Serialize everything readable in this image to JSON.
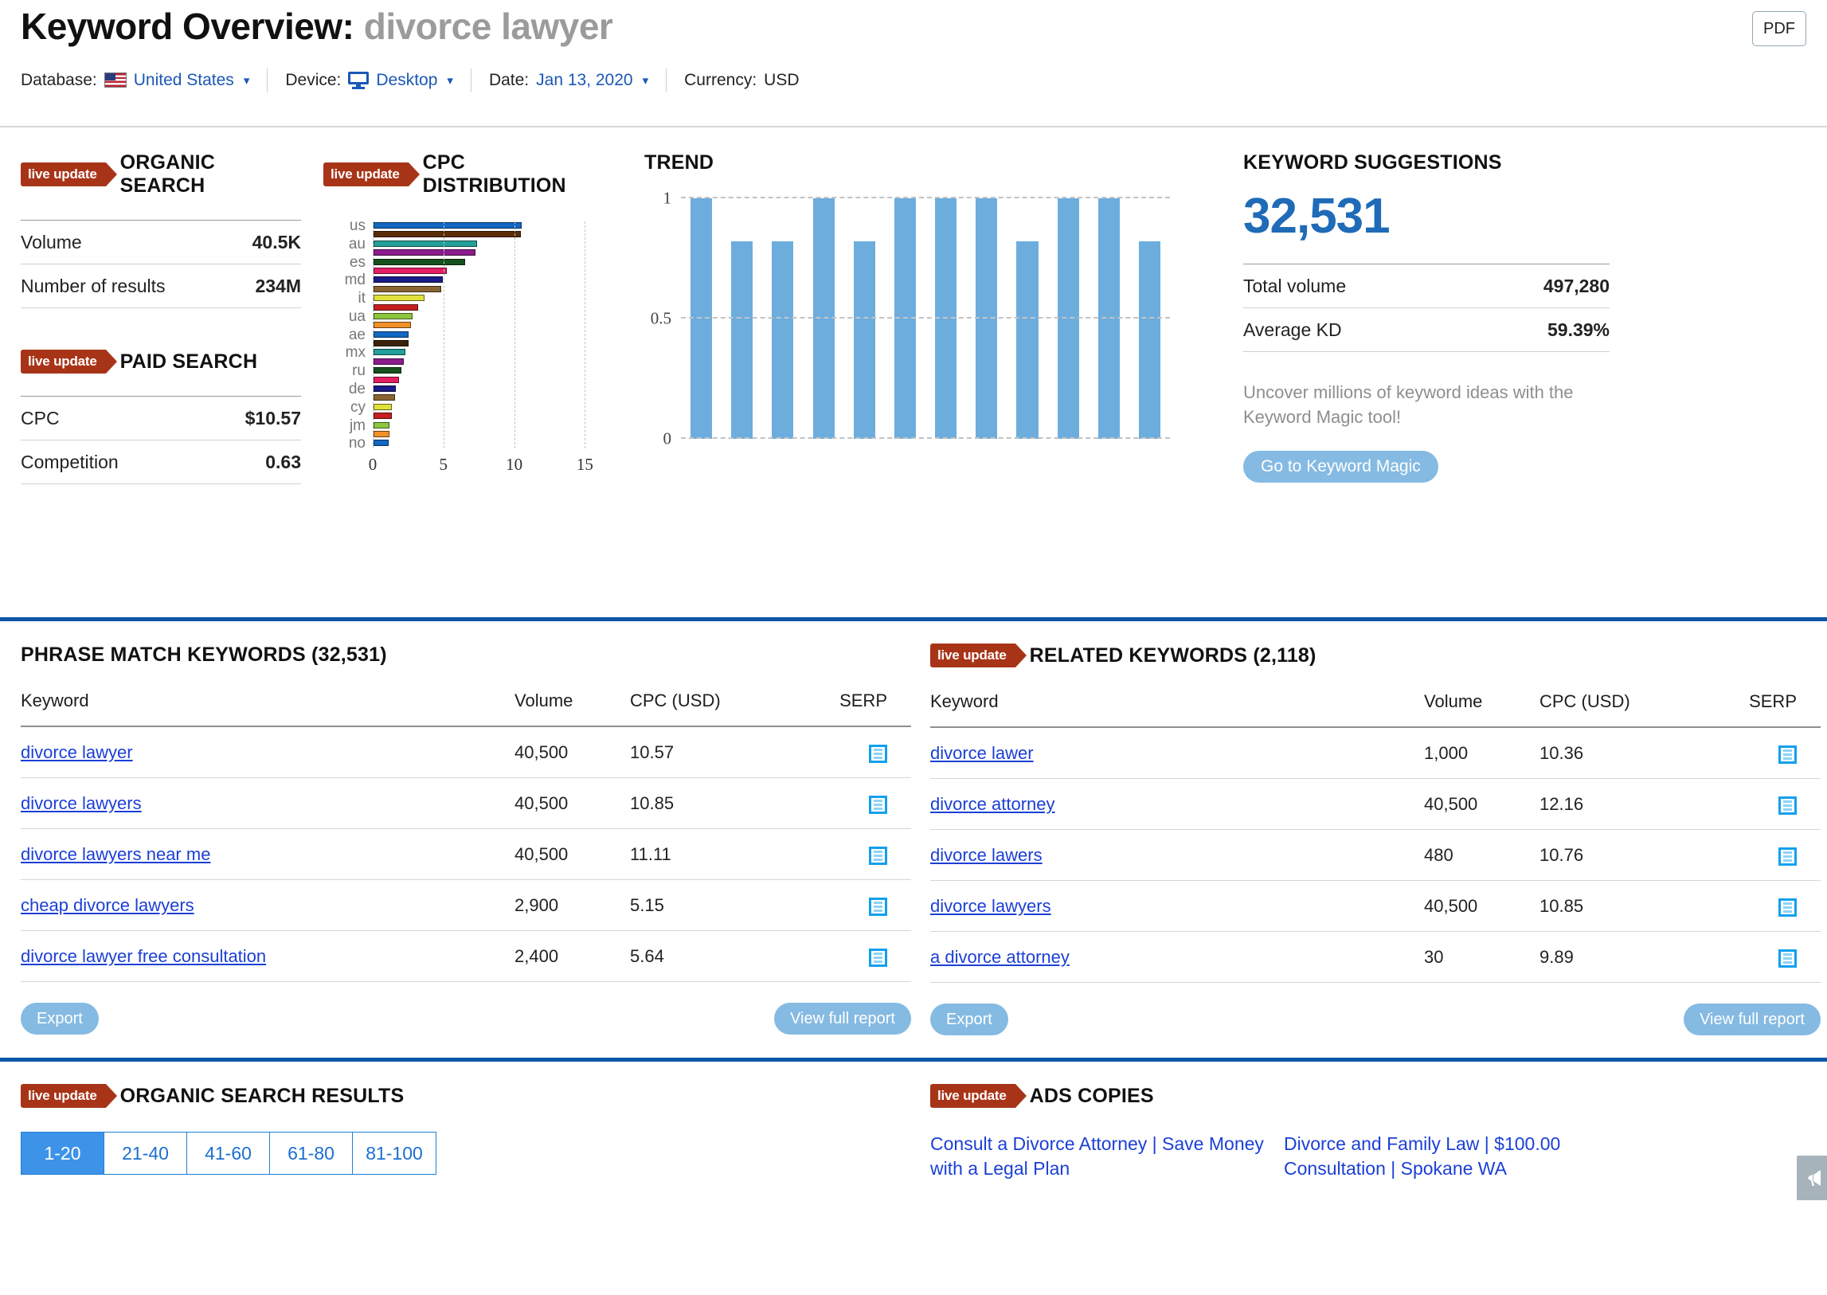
{
  "header": {
    "title_prefix": "Keyword Overview:",
    "keyword": "divorce lawyer",
    "pdf_label": "PDF",
    "database_label": "Database:",
    "database_value": "United States",
    "device_label": "Device:",
    "device_value": "Desktop",
    "date_label": "Date:",
    "date_value": "Jan 13, 2020",
    "currency_label": "Currency:",
    "currency_value": "USD"
  },
  "badges": {
    "live_update": "live update"
  },
  "organic_search": {
    "title": "ORGANIC SEARCH",
    "rows": [
      {
        "label": "Volume",
        "value": "40.5K"
      },
      {
        "label": "Number of results",
        "value": "234M"
      }
    ]
  },
  "paid_search": {
    "title": "PAID SEARCH",
    "rows": [
      {
        "label": "CPC",
        "value": "$10.57"
      },
      {
        "label": "Competition",
        "value": "0.63"
      }
    ]
  },
  "cpc_distribution": {
    "title": "CPC DISTRIBUTION"
  },
  "trend": {
    "title": "TREND"
  },
  "keyword_suggestions": {
    "title": "KEYWORD SUGGESTIONS",
    "count": "32,531",
    "rows": [
      {
        "label": "Total volume",
        "value": "497,280"
      },
      {
        "label": "Average KD",
        "value": "59.39%"
      }
    ],
    "note": "Uncover millions of keyword ideas with the Keyword Magic tool!",
    "cta": "Go to Keyword Magic"
  },
  "phrase_match": {
    "title": "PHRASE MATCH KEYWORDS (32,531)",
    "columns": [
      "Keyword",
      "Volume",
      "CPC (USD)",
      "SERP"
    ],
    "rows": [
      {
        "keyword": "divorce lawyer",
        "volume": "40,500",
        "cpc": "10.57",
        "serp": "serp-icon"
      },
      {
        "keyword": "divorce lawyers",
        "volume": "40,500",
        "cpc": "10.85",
        "serp": "serp-icon"
      },
      {
        "keyword": "divorce lawyers near me",
        "volume": "40,500",
        "cpc": "11.11",
        "serp": "serp-icon"
      },
      {
        "keyword": "cheap divorce lawyers",
        "volume": "2,900",
        "cpc": "5.15",
        "serp": "serp-icon"
      },
      {
        "keyword": "divorce lawyer free consultation",
        "volume": "2,400",
        "cpc": "5.64",
        "serp": "serp-icon"
      }
    ],
    "export_label": "Export",
    "view_full_label": "View full report"
  },
  "related_keywords": {
    "title": "RELATED KEYWORDS (2,118)",
    "columns": [
      "Keyword",
      "Volume",
      "CPC (USD)",
      "SERP"
    ],
    "rows": [
      {
        "keyword": "divorce lawer",
        "volume": "1,000",
        "cpc": "10.36",
        "serp": "serp-icon"
      },
      {
        "keyword": "divorce attorney",
        "volume": "40,500",
        "cpc": "12.16",
        "serp": "serp-icon"
      },
      {
        "keyword": "divorce lawers",
        "volume": "480",
        "cpc": "10.76",
        "serp": "serp-icon"
      },
      {
        "keyword": "divorce lawyers",
        "volume": "40,500",
        "cpc": "10.85",
        "serp": "serp-icon"
      },
      {
        "keyword": "a divorce attorney",
        "volume": "30",
        "cpc": "9.89",
        "serp": "serp-icon"
      }
    ],
    "export_label": "Export",
    "view_full_label": "View full report"
  },
  "organic_search_results": {
    "title": "ORGANIC SEARCH RESULTS",
    "pages": [
      "1-20",
      "21-40",
      "41-60",
      "61-80",
      "81-100"
    ],
    "active_page": "1-20"
  },
  "ads_copies": {
    "title": "ADS COPIES",
    "items": [
      "Consult a Divorce Attorney | Save Money with a Legal Plan",
      "Divorce and Family Law | $100.00 Consultation | Spokane WA"
    ]
  },
  "colors": {
    "accent_blue": "#1b57b5",
    "divider_blue": "#0d55a8",
    "live_badge_red": "#a83418",
    "link_blue": "#1b3fd6",
    "trend_bar": "#6cadde",
    "button_blue": "#85bae2"
  },
  "chart_data": [
    {
      "type": "bar",
      "title": "CPC DISTRIBUTION",
      "orientation": "horizontal",
      "xlabel": "",
      "ylabel": "",
      "xlim": [
        0,
        16.5
      ],
      "xticks": [
        0,
        5,
        10,
        15
      ],
      "grid": true,
      "categories": [
        "us",
        "",
        "au",
        "",
        "es",
        "",
        "md",
        "",
        "it",
        "",
        "ua",
        "",
        "ae",
        "",
        "mx",
        "",
        "ru",
        "",
        "de",
        "",
        "cy",
        "",
        "jm",
        "",
        "no"
      ],
      "visible_labels": [
        "us",
        "au",
        "es",
        "md",
        "it",
        "ua",
        "ae",
        "mx",
        "ru",
        "de",
        "cy",
        "jm",
        "no"
      ],
      "values": [
        10.5,
        10.45,
        7.35,
        7.25,
        6.5,
        5.2,
        4.9,
        4.8,
        3.6,
        3.15,
        2.75,
        2.65,
        2.5,
        2.5,
        2.25,
        2.15,
        2.0,
        1.8,
        1.6,
        1.5,
        1.3,
        1.3,
        1.15,
        1.15,
        1.1
      ],
      "bar_colors": [
        "#1268c3",
        "#5a2c08",
        "#22a09a",
        "#8d1b8d",
        "#14511c",
        "#e51e63",
        "#191b86",
        "#8a6531",
        "#e0e03a",
        "#c52020",
        "#8cc63f",
        "#f09027",
        "#1268c3",
        "#3b2209",
        "#22a09a",
        "#8d1b8d",
        "#14511c",
        "#e51e63",
        "#191b86",
        "#8a6531",
        "#e0e03a",
        "#c52020",
        "#8cc63f",
        "#f09027",
        "#1268c3"
      ]
    },
    {
      "type": "bar",
      "title": "TREND",
      "orientation": "vertical",
      "xlabel": "",
      "ylabel": "",
      "ylim": [
        0,
        1
      ],
      "yticks": [
        0,
        0.5,
        1
      ],
      "ytick_labels": [
        "0",
        "0.5",
        "1"
      ],
      "grid": true,
      "categories": [
        "1",
        "2",
        "3",
        "4",
        "5",
        "6",
        "7",
        "8",
        "9",
        "10",
        "11",
        "12"
      ],
      "values": [
        1,
        0.82,
        0.82,
        1,
        0.82,
        1,
        1,
        1,
        0.82,
        1,
        1,
        0.82
      ],
      "bar_color": "#6cadde"
    }
  ]
}
